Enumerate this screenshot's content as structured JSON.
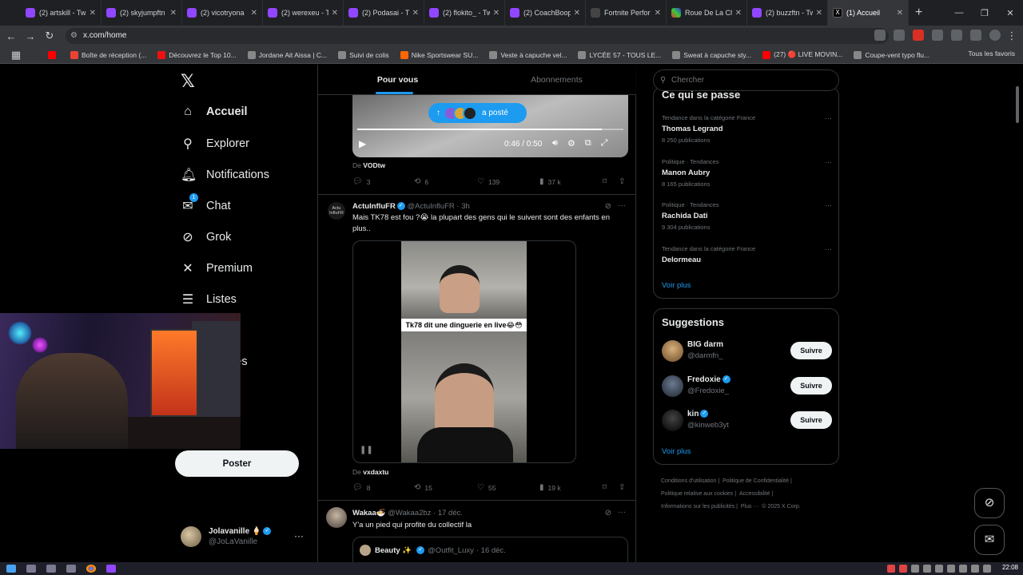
{
  "browser": {
    "tabs": [
      {
        "label": "(2) artskill - Tw",
        "icon": "twitch-icon"
      },
      {
        "label": "(2) skyjumpftn",
        "icon": "twitch-icon"
      },
      {
        "label": "(2) vicotryona",
        "icon": "twitch-icon"
      },
      {
        "label": "(2) werexeu - T",
        "icon": "twitch-icon"
      },
      {
        "label": "(2) Podasai - Tw",
        "icon": "twitch-icon"
      },
      {
        "label": "(2) flokito_ - Tw",
        "icon": "twitch-icon"
      },
      {
        "label": "(2) CoachBoop",
        "icon": "twitch-icon"
      },
      {
        "label": "Fortnite Perfor",
        "icon": "fortnite-icon"
      },
      {
        "label": "Roue De La Ch",
        "icon": "wheel-icon"
      },
      {
        "label": "(2) buzzftn - Tw",
        "icon": "twitch-icon"
      },
      {
        "label": "(1) Accueil",
        "icon": "x-icon",
        "active": true
      }
    ],
    "new_tab": "+",
    "url": "x.com/home",
    "bookmarks": [
      {
        "label": "",
        "icon": "youtube-icon"
      },
      {
        "label": "Boîte de réception (...",
        "icon": "gmail-icon"
      },
      {
        "label": "Découvrez le Top 10...",
        "icon": "tf1-icon"
      },
      {
        "label": "Jordane Ait Aissa | C...",
        "icon": "bookmark-icon"
      },
      {
        "label": "Suivi de colis",
        "icon": "bookmark-icon"
      },
      {
        "label": "Nike Sportswear SU...",
        "icon": "nike-icon"
      },
      {
        "label": "Veste à capuche vel...",
        "icon": "bookmark-icon"
      },
      {
        "label": "LYCÉE 57 - TOUS LE...",
        "icon": "bookmark-icon"
      },
      {
        "label": "Sweat à capuche sty...",
        "icon": "bookmark-icon"
      },
      {
        "label": "(27) 🔴 LIVE MOVIN...",
        "icon": "youtube-icon"
      },
      {
        "label": "Coupe-vent typo flu...",
        "icon": "bookmark-icon"
      }
    ],
    "all_favorites": "Tous les favoris"
  },
  "nav": {
    "items": [
      {
        "label": "Accueil",
        "icon": "home-icon"
      },
      {
        "label": "Explorer",
        "icon": "search-icon"
      },
      {
        "label": "Notifications",
        "icon": "bell-icon"
      },
      {
        "label": "Chat",
        "icon": "mail-icon",
        "badge": "1"
      },
      {
        "label": "Grok",
        "icon": "grok-icon"
      },
      {
        "label": "Premium",
        "icon": "x-icon"
      },
      {
        "label": "Listes",
        "icon": "list-icon"
      },
      {
        "label": "s",
        "icon": "bookmark-icon"
      },
      {
        "label": "unautés",
        "icon": "communities-icon"
      }
    ],
    "post_button": "Poster",
    "account": {
      "name": "Jolavanille 🍦",
      "handle": "@JoLaVanille"
    }
  },
  "feed": {
    "tabs": [
      "Pour vous",
      "Abonnements"
    ],
    "posted_pill": "a posté",
    "tweet1": {
      "video_time": "0:46 / 0:50",
      "progress": 0.92,
      "source_prefix": "De",
      "source": "VODtw",
      "replies": "3",
      "reposts": "6",
      "likes": "139",
      "views": "37 k"
    },
    "tweet2": {
      "name": "ActuInfluFR",
      "handle": "@ActuInfluFR",
      "time": "· 3h",
      "avatar_text": "Actu InfluFR",
      "text": "Mais TK78 est fou ?😭 la plupart des gens qui le suivent sont des enfants en plus..",
      "caption": "Tk78 dit une dinguerie en live😂😳",
      "source_prefix": "De",
      "source": "vxdaxtu",
      "replies": "8",
      "reposts": "15",
      "likes": "55",
      "views": "19 k"
    },
    "tweet3": {
      "name": "Wakaa🍜",
      "handle": "@Wakaa2bz",
      "time": "· 17 déc.",
      "text": "Y'a un pied qui profite du collectif la",
      "quote": {
        "name": "Beauty ✨",
        "handle": "@Outfit_Luxy",
        "time": "· 16 déc."
      }
    }
  },
  "sidebar": {
    "search_placeholder": "Chercher",
    "trends_title": "Ce qui se passe",
    "trends": [
      {
        "meta": "Tendance dans la catégorie France",
        "title": "Thomas Legrand",
        "count": "8 250 publications"
      },
      {
        "meta": "Politique · Tendances",
        "title": "Manon Aubry",
        "count": "8 165 publications"
      },
      {
        "meta": "Politique · Tendances",
        "title": "Rachida Dati",
        "count": "9 304 publications"
      },
      {
        "meta": "Tendance dans la catégorie France",
        "title": "Delormeau",
        "count": ""
      }
    ],
    "trends_more": "Voir plus",
    "suggestions_title": "Suggestions",
    "suggestions": [
      {
        "name": "BIG darm",
        "handle": "@darmfn_",
        "verified": false,
        "follow": "Suivre"
      },
      {
        "name": "Fredoxie",
        "handle": "@Fredoxie_",
        "verified": true,
        "follow": "Suivre"
      },
      {
        "name": "kin",
        "handle": "@kinweb3yt",
        "verified": true,
        "follow": "Suivre"
      }
    ],
    "suggestions_more": "Voir plus",
    "footer": [
      "Conditions d'utilisation",
      "|",
      "Politique de Confidentialité",
      "|",
      "Politique relative aux cookies",
      "|",
      "Accessibilité",
      "|",
      "Informations sur les publicités",
      "|",
      "Plus ···",
      "© 2025 X Corp."
    ]
  },
  "taskbar": {
    "clock": "22:08"
  },
  "colors": {
    "accent": "#1d9bf0",
    "background": "#000000",
    "text": "#e7e9ea",
    "muted": "#71767b"
  }
}
